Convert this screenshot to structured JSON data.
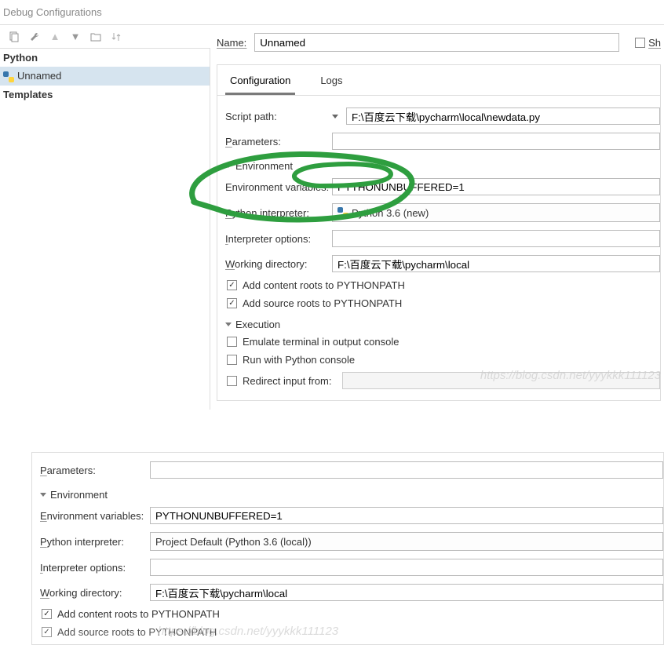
{
  "window_title": "Debug Configurations",
  "tree": {
    "root": "Python",
    "selected": "Unnamed",
    "templates": "Templates"
  },
  "name_label": "Name:",
  "name_value": "Unnamed",
  "share_label": "Sh",
  "tabs": {
    "config": "Configuration",
    "logs": "Logs"
  },
  "form": {
    "script_path_label": "Script path:",
    "script_path_value": "F:\\百度云下载\\pycharm\\local\\newdata.py",
    "parameters_label": "Parameters:",
    "env_section": "Environment",
    "env_vars_label": "Environment variables:",
    "env_vars_value": "PYTHONUNBUFFERED=1",
    "python_interp_label": "Python interpreter:",
    "python_interp_value": "Python 3.6 (new)",
    "interp_options_label": "Interpreter options:",
    "working_dir_label": "Working directory:",
    "working_dir_value": "F:\\百度云下载\\pycharm\\local",
    "add_content_roots": "Add content roots to PYTHONPATH",
    "add_source_roots": "Add source roots to PYTHONPATH",
    "execution_section": "Execution",
    "emulate_terminal": "Emulate terminal in output console",
    "run_python_console": "Run with Python console",
    "redirect_input": "Redirect input from:"
  },
  "lower": {
    "parameters_label": "Parameters:",
    "env_section": "Environment",
    "env_vars_label": "Environment variables:",
    "env_vars_value": "PYTHONUNBUFFERED=1",
    "python_interp_label": "Python interpreter:",
    "python_interp_value": "Project Default (Python 3.6 (local))",
    "interp_options_label": "Interpreter options:",
    "working_dir_label": "Working directory:",
    "working_dir_value": "F:\\百度云下载\\pycharm\\local",
    "add_content_roots": "Add content roots to PYTHONPATH",
    "add_source_roots": "Add source roots to PYTHONPATH"
  },
  "watermark1": "https://blog.csdn.net/yyykkk111123",
  "watermark2": "https://blog.csdn.net/yyykkk111123"
}
